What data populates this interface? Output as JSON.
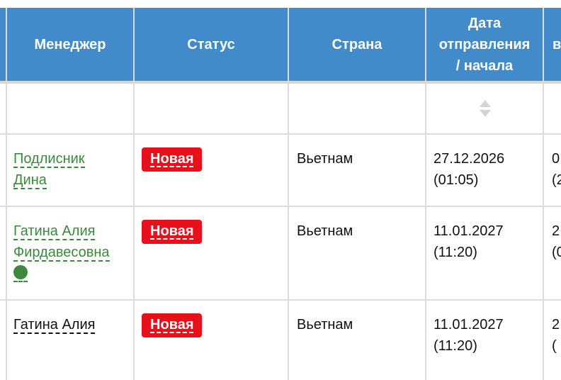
{
  "headers": {
    "manager": "Менеджер",
    "status": "Статус",
    "country": "Страна",
    "date_line1": "Дата",
    "date_line2": "отправления",
    "date_line3": "/ начала",
    "next_partial": "в"
  },
  "icons": {
    "sort": "sort-icon",
    "online": "online-dot-icon"
  },
  "rows": [
    {
      "manager_line1": "Подлисник",
      "manager_line2": "Дина",
      "status": "Новая",
      "country": "Вьетнам",
      "date": "27.12.2026",
      "time": "(01:05)",
      "next_line1": "0",
      "next_line2": "(2"
    },
    {
      "manager_line1": "Гатина Алия",
      "manager_line2": "Фирдавесовна",
      "status": "Новая",
      "country": "Вьетнам",
      "date": "11.01.2027",
      "time": "(11:20)",
      "next_line1": "2",
      "next_line2": "(0"
    },
    {
      "manager_line1": "Гатина Алия",
      "status": "Новая",
      "country": "Вьетнам",
      "date": "11.01.2027",
      "time": "(11:20)",
      "next_line1": "2",
      "next_line2": "("
    }
  ],
  "colors": {
    "header_bg": "#428bca",
    "badge_bg": "#e8101a",
    "link_green": "#3b8a3b"
  }
}
